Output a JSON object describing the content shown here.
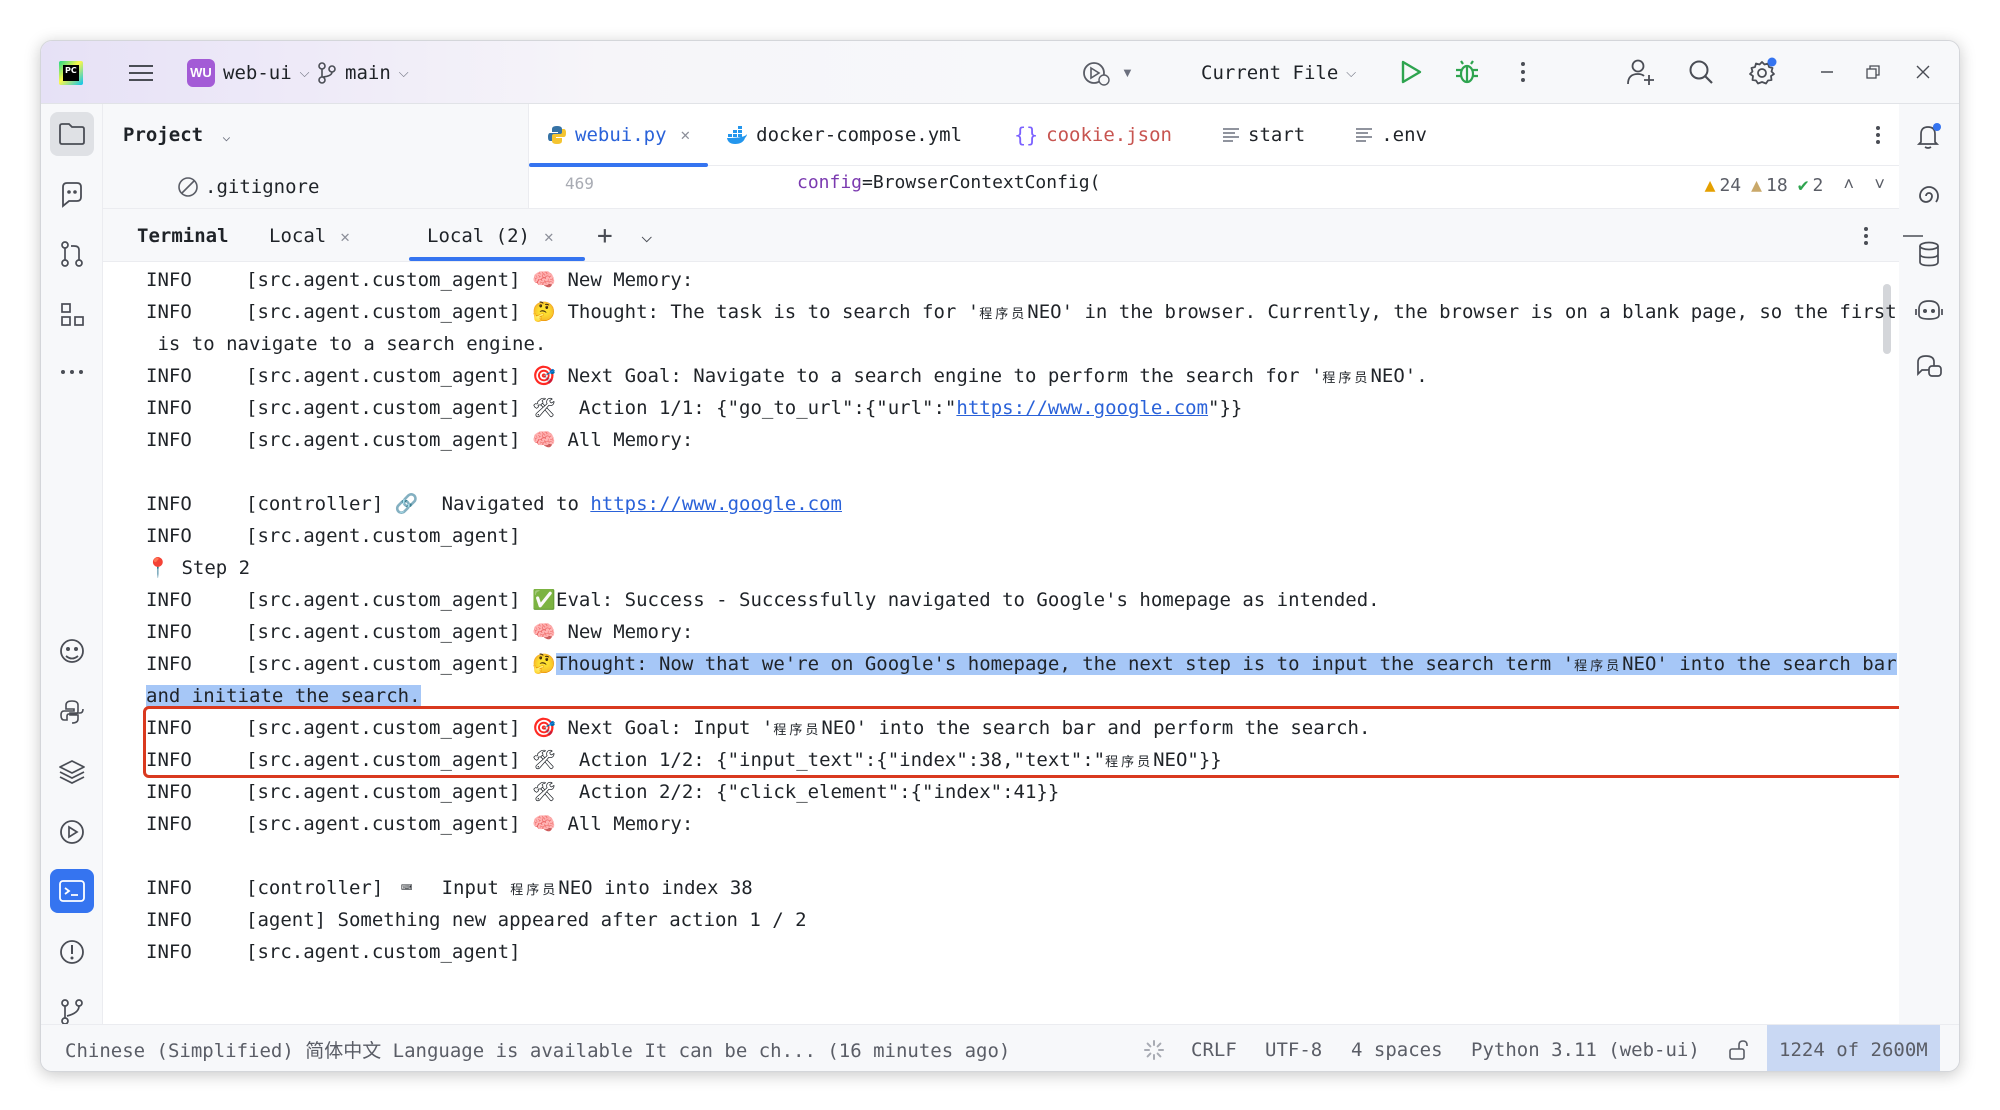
{
  "titlebar": {
    "project_badge": "WU",
    "project_name": "web-ui",
    "branch": "main",
    "run_config": "Current File"
  },
  "project_pane": {
    "title": "Project",
    "file_row": ".gitignore"
  },
  "editor": {
    "tabs": [
      {
        "label": "webui.py",
        "active": true
      },
      {
        "label": "docker-compose.yml"
      },
      {
        "label": "cookie.json"
      },
      {
        "label": "start"
      },
      {
        "label": ".env"
      }
    ],
    "line_number": "469",
    "code_param": "config",
    "code_rest": "=BrowserContextConfig(",
    "inspections": {
      "warnings_a": "24",
      "warnings_b": "18",
      "ok": "2"
    }
  },
  "terminal": {
    "title": "Terminal",
    "tabs": [
      "Local",
      "Local (2)"
    ],
    "lines": {
      "l1": {
        "lvl": "INFO",
        "src": "[src.agent.custom_agent]",
        "emoji": "🧠",
        "text": " New Memory:"
      },
      "l2": {
        "lvl": "INFO",
        "src": "[src.agent.custom_agent]",
        "emoji": "🤔",
        "text_a": " Thought: The task is to search for '",
        "cjk": "程序员",
        "text_b": "NEO' in the browser. Currently, the browser is on a blank page, so the first s"
      },
      "l3": {
        "text": " is to navigate to a search engine."
      },
      "l4": {
        "lvl": "INFO",
        "src": "[src.agent.custom_agent]",
        "emoji": "🎯",
        "text_a": " Next Goal: Navigate to a search engine to perform the search for '",
        "cjk": "程序员",
        "text_b": "NEO'."
      },
      "l5": {
        "lvl": "INFO",
        "src": "[src.agent.custom_agent]",
        "emoji": "🛠",
        "text_a": "  Action 1/1: {\"go_to_url\":{\"url\":\"",
        "link": "https://www.google.com",
        "text_b": "\"}}"
      },
      "l6": {
        "lvl": "INFO",
        "src": "[src.agent.custom_agent]",
        "emoji": "🧠",
        "text": " All Memory:"
      },
      "l7": {
        "lvl": "INFO",
        "src": "[controller]",
        "emoji": "🔗",
        "text_a": "  Navigated to ",
        "link": "https://www.google.com"
      },
      "l8": {
        "lvl": "INFO",
        "src": "[src.agent.custom_agent]"
      },
      "l9": {
        "emoji": "📍",
        "text": " Step 2"
      },
      "l10": {
        "lvl": "INFO",
        "src": "[src.agent.custom_agent]",
        "emoji": "✅",
        "text": "Eval: Success - Successfully navigated to Google's homepage as intended."
      },
      "l11": {
        "lvl": "INFO",
        "src": "[src.agent.custom_agent]",
        "emoji": "🧠",
        "text": " New Memory:"
      },
      "l12": {
        "lvl": "INFO",
        "src": "[src.agent.custom_agent]",
        "emoji": "🤔",
        "text_a": "Thought: Now that we're on Google's homepage, the next step is to input the search term '",
        "cjk": "程序员",
        "text_b": "NEO' into the search bar"
      },
      "l13": {
        "text": "and initiate the search."
      },
      "l14": {
        "lvl": "INFO",
        "src": "[src.agent.custom_agent]",
        "emoji": "🎯",
        "text_a": " Next Goal: Input '",
        "cjk": "程序员",
        "text_b": "NEO' into the search bar and perform the search."
      },
      "l15": {
        "lvl": "INFO",
        "src": "[src.agent.custom_agent]",
        "emoji": "🛠",
        "text_a": "  Action 1/2: {\"input_text\":{\"index\":38,\"text\":\"",
        "cjk": "程序员",
        "text_b": "NEO\"}}"
      },
      "l16": {
        "lvl": "INFO",
        "src": "[src.agent.custom_agent]",
        "emoji": "🛠",
        "text": "  Action 2/2: {\"click_element\":{\"index\":41}}"
      },
      "l17": {
        "lvl": "INFO",
        "src": "[src.agent.custom_agent]",
        "emoji": "🧠",
        "text": " All Memory:"
      },
      "l18": {
        "lvl": "INFO",
        "src": "[controller]",
        "emoji": "⌨",
        "text_a": "  Input ",
        "cjk": "程序员",
        "text_b": "NEO into index 38"
      },
      "l19": {
        "lvl": "INFO",
        "src": "[agent]",
        "text": " Something new appeared after action 1 / 2"
      },
      "l20": {
        "lvl": "INFO",
        "src": "[src.agent.custom_agent]"
      }
    }
  },
  "statusbar": {
    "message": "Chinese (Simplified) 简体中文 Language is available It can be ch... (16 minutes ago)",
    "line_sep": "CRLF",
    "encoding": "UTF-8",
    "indent": "4 spaces",
    "interpreter": "Python 3.11 (web-ui)",
    "memory": "1224 of 2600M"
  },
  "icons": {
    "brand_purple": "#a35bd6",
    "accent_blue": "#3574f0",
    "highlight_red": "#d9391f"
  }
}
